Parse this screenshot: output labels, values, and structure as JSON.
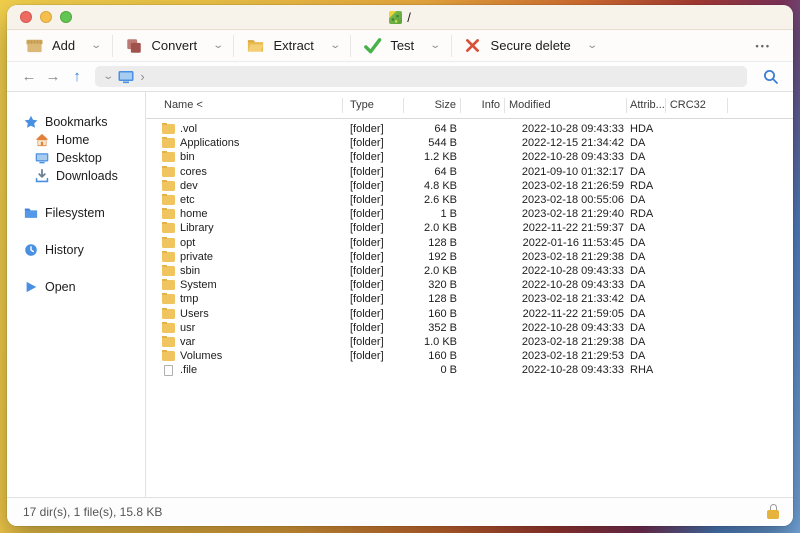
{
  "window": {
    "title": "/"
  },
  "toolbar": {
    "buttons": [
      {
        "label": "Add"
      },
      {
        "label": "Convert"
      },
      {
        "label": "Extract"
      },
      {
        "label": "Test"
      },
      {
        "label": "Secure delete"
      }
    ],
    "more_label": "•••"
  },
  "sidebar": {
    "items": [
      {
        "label": "Bookmarks"
      },
      {
        "label": "Home"
      },
      {
        "label": "Desktop"
      },
      {
        "label": "Downloads"
      },
      {
        "label": "Filesystem"
      },
      {
        "label": "History"
      },
      {
        "label": "Open"
      }
    ]
  },
  "table": {
    "columns": [
      "Name <",
      "Type",
      "Size",
      "Info",
      "Modified",
      "Attrib...",
      "CRC32"
    ],
    "rows": [
      {
        "name": ".vol",
        "icon": "folder",
        "type": "[folder]",
        "size": "64 B",
        "info": "",
        "modified": "2022-10-28 09:43:33",
        "attrib": "HDA",
        "crc32": ""
      },
      {
        "name": "Applications",
        "icon": "folder",
        "type": "[folder]",
        "size": "544 B",
        "info": "",
        "modified": "2022-12-15 21:34:42",
        "attrib": "DA",
        "crc32": ""
      },
      {
        "name": "bin",
        "icon": "folder",
        "type": "[folder]",
        "size": "1.2 KB",
        "info": "",
        "modified": "2022-10-28 09:43:33",
        "attrib": "DA",
        "crc32": ""
      },
      {
        "name": "cores",
        "icon": "folder",
        "type": "[folder]",
        "size": "64 B",
        "info": "",
        "modified": "2021-09-10 01:32:17",
        "attrib": "DA",
        "crc32": ""
      },
      {
        "name": "dev",
        "icon": "folder",
        "type": "[folder]",
        "size": "4.8 KB",
        "info": "",
        "modified": "2023-02-18 21:26:59",
        "attrib": "RDA",
        "crc32": ""
      },
      {
        "name": "etc",
        "icon": "folder",
        "type": "[folder]",
        "size": "2.6 KB",
        "info": "",
        "modified": "2023-02-18 00:55:06",
        "attrib": "DA",
        "crc32": ""
      },
      {
        "name": "home",
        "icon": "folder",
        "type": "[folder]",
        "size": "1 B",
        "info": "",
        "modified": "2023-02-18 21:29:40",
        "attrib": "RDA",
        "crc32": ""
      },
      {
        "name": "Library",
        "icon": "folder",
        "type": "[folder]",
        "size": "2.0 KB",
        "info": "",
        "modified": "2022-11-22 21:59:37",
        "attrib": "DA",
        "crc32": ""
      },
      {
        "name": "opt",
        "icon": "folder",
        "type": "[folder]",
        "size": "128 B",
        "info": "",
        "modified": "2022-01-16 11:53:45",
        "attrib": "DA",
        "crc32": ""
      },
      {
        "name": "private",
        "icon": "folder",
        "type": "[folder]",
        "size": "192 B",
        "info": "",
        "modified": "2023-02-18 21:29:38",
        "attrib": "DA",
        "crc32": ""
      },
      {
        "name": "sbin",
        "icon": "folder",
        "type": "[folder]",
        "size": "2.0 KB",
        "info": "",
        "modified": "2022-10-28 09:43:33",
        "attrib": "DA",
        "crc32": ""
      },
      {
        "name": "System",
        "icon": "folder",
        "type": "[folder]",
        "size": "320 B",
        "info": "",
        "modified": "2022-10-28 09:43:33",
        "attrib": "DA",
        "crc32": ""
      },
      {
        "name": "tmp",
        "icon": "folder",
        "type": "[folder]",
        "size": "128 B",
        "info": "",
        "modified": "2023-02-18 21:33:42",
        "attrib": "DA",
        "crc32": ""
      },
      {
        "name": "Users",
        "icon": "folder",
        "type": "[folder]",
        "size": "160 B",
        "info": "",
        "modified": "2022-11-22 21:59:05",
        "attrib": "DA",
        "crc32": ""
      },
      {
        "name": "usr",
        "icon": "folder",
        "type": "[folder]",
        "size": "352 B",
        "info": "",
        "modified": "2022-10-28 09:43:33",
        "attrib": "DA",
        "crc32": ""
      },
      {
        "name": "var",
        "icon": "folder",
        "type": "[folder]",
        "size": "1.0 KB",
        "info": "",
        "modified": "2023-02-18 21:29:38",
        "attrib": "DA",
        "crc32": ""
      },
      {
        "name": "Volumes",
        "icon": "folder",
        "type": "[folder]",
        "size": "160 B",
        "info": "",
        "modified": "2023-02-18 21:29:53",
        "attrib": "DA",
        "crc32": ""
      },
      {
        "name": ".file",
        "icon": "file",
        "type": "",
        "size": "0 B",
        "info": "",
        "modified": "2022-10-28 09:43:33",
        "attrib": "RHA",
        "crc32": ""
      }
    ]
  },
  "statusbar": {
    "summary": "17 dir(s), 1 file(s), 15.8 KB"
  }
}
